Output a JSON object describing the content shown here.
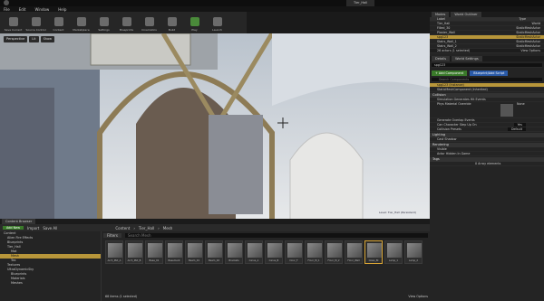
{
  "window": {
    "tab_title": "Tier_Hall"
  },
  "menu": [
    "File",
    "Edit",
    "Window",
    "Help"
  ],
  "toolbar": [
    "Save Current",
    "Source Control",
    "Content",
    "Marketplace",
    "Settings",
    "Blueprints",
    "Cinematics",
    "Build",
    "Play",
    "Launch"
  ],
  "viewport": {
    "buttons": [
      "Perspective",
      "Lit",
      "Show"
    ],
    "status": "Level: Tier_Hall (Persistent)"
  },
  "outliner": {
    "tabs": [
      "Modes",
      "World Outliner"
    ],
    "col_label": "Label",
    "col_type": "Type",
    "rows": [
      {
        "label": "Tier_Hall",
        "type": "World"
      },
      {
        "label": "Filled_30",
        "type": "StaticMeshActor"
      },
      {
        "label": "Plaster_Wall",
        "type": "StaticMeshActor"
      },
      {
        "label": "spg123",
        "type": "StaticMeshActor"
      },
      {
        "label": "Stairs_Wall_1",
        "type": "StaticMeshActor"
      },
      {
        "label": "Stairs_Wall_2",
        "type": "StaticMeshActor"
      }
    ],
    "footer": "26 actors (1 selected)",
    "view_options": "View Options"
  },
  "details": {
    "tabs": [
      "Details",
      "World Settings"
    ],
    "name": "spg123",
    "add_component": "+ Add Component",
    "blueprint": "Blueprint/Add Script",
    "search": "Search Components",
    "components": [
      "spg123 (Instance)",
      "StaticMeshComponent (Inherited)"
    ],
    "sections": [
      "Collision",
      "Lighting",
      "Rendering",
      "Tags"
    ],
    "collision_rows": [
      "Simulation Generates Hit Events",
      "Phys Material Override",
      "Generate Overlap Events",
      "Can Character Step Up On",
      "Collision Presets"
    ],
    "lighting_rows": [
      "Cast Shadow"
    ],
    "rendering_rows": [
      "Visible",
      "Actor Hidden In Game"
    ],
    "step_up_value": "Yes",
    "presets_value": "Default",
    "tags_value": "0 Array elements",
    "physmat_value": "None"
  },
  "content": {
    "tab": "Content Browser",
    "add_new": "Add New",
    "import": "Import",
    "save_all": "Save All",
    "breadcrumb": [
      "Content",
      "Tier_Hall",
      "Mesh"
    ],
    "filters": "Filters",
    "search": "Search Mesh",
    "folders": [
      "Content",
      "Alien Fire Effects",
      "Blueprints",
      "Tier_Hall",
      "Mat",
      "Mesh",
      "Tex",
      "Textures",
      "UltraDynamicSky",
      "Blueprints",
      "Materials",
      "Meshes"
    ],
    "assets": [
      "Arch_Mid_A",
      "Arch_Mid_B",
      "Base_01",
      "Basement",
      "Beam_01",
      "Beam_02",
      "Brackets",
      "Carve_A",
      "Carve_B",
      "Door_F",
      "Floor_M_1",
      "Floor_M_2",
      "Floor_Wall",
      "Glass_Bl",
      "Lamp_1",
      "Lamp_2"
    ],
    "status": "68 items (1 selected)",
    "view_options": "View Options"
  }
}
